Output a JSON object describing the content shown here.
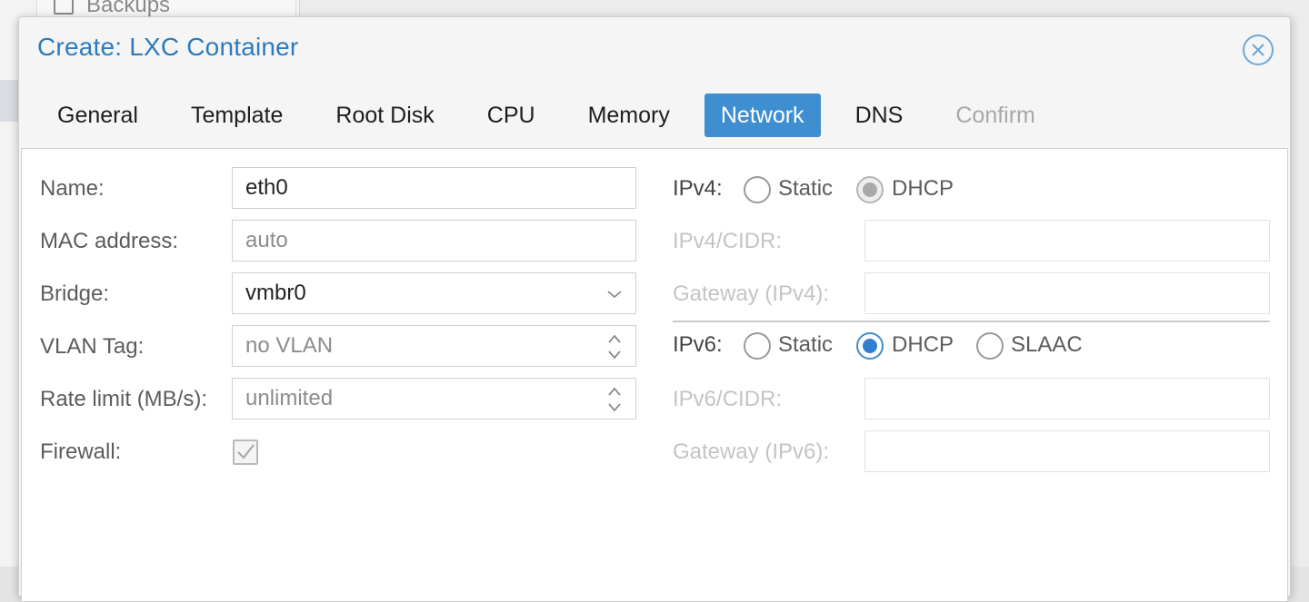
{
  "background": {
    "sidebar_item_label": "Backups"
  },
  "dialog": {
    "title": "Create: LXC Container",
    "close_icon": "close-circle-icon"
  },
  "tabs": [
    {
      "label": "General",
      "state": "normal"
    },
    {
      "label": "Template",
      "state": "normal"
    },
    {
      "label": "Root Disk",
      "state": "normal"
    },
    {
      "label": "CPU",
      "state": "normal"
    },
    {
      "label": "Memory",
      "state": "normal"
    },
    {
      "label": "Network",
      "state": "active"
    },
    {
      "label": "DNS",
      "state": "normal"
    },
    {
      "label": "Confirm",
      "state": "disabled"
    }
  ],
  "form": {
    "name": {
      "label": "Name:",
      "value": "eth0"
    },
    "mac": {
      "label": "MAC address:",
      "placeholder": "auto"
    },
    "bridge": {
      "label": "Bridge:",
      "value": "vmbr0"
    },
    "vlan": {
      "label": "VLAN Tag:",
      "placeholder": "no VLAN"
    },
    "rate": {
      "label": "Rate limit (MB/s):",
      "placeholder": "unlimited"
    },
    "firewall": {
      "label": "Firewall:",
      "checked": true
    },
    "ipv4": {
      "label": "IPv4:",
      "options": [
        "Static",
        "DHCP"
      ],
      "selected": "DHCP",
      "cidr_label": "IPv4/CIDR:",
      "cidr_value": "",
      "gateway_label": "Gateway (IPv4):",
      "gateway_value": ""
    },
    "ipv6": {
      "label": "IPv6:",
      "options": [
        "Static",
        "DHCP",
        "SLAAC"
      ],
      "selected": "DHCP",
      "cidr_label": "IPv6/CIDR:",
      "cidr_value": "",
      "gateway_label": "Gateway (IPv6):",
      "gateway_value": ""
    }
  },
  "colors": {
    "accent": "#3e8ed0",
    "title": "#2d7bbd",
    "disabled_text": "#c4c4c4"
  }
}
